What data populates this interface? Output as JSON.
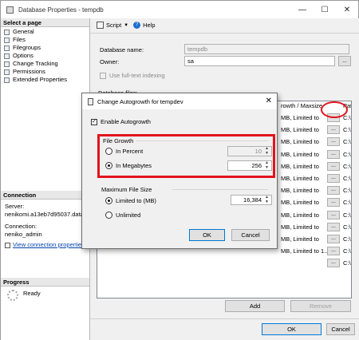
{
  "window": {
    "title": "Database Properties - tempdb"
  },
  "left": {
    "select_page": "Select a page",
    "pages": [
      "General",
      "Files",
      "Filegroups",
      "Options",
      "Change Tracking",
      "Permissions",
      "Extended Properties"
    ],
    "connection_head": "Connection",
    "server_label": "Server:",
    "server_value": "nenikomi.a13eb7d95037.datab",
    "conn_label": "Connection:",
    "conn_value": "neniko_admin",
    "view_conn": "View connection properties",
    "progress_head": "Progress",
    "progress_status": "Ready"
  },
  "toolbar": {
    "script": "Script",
    "help": "Help"
  },
  "form": {
    "dbname_label": "Database name:",
    "dbname_value": "tempdb",
    "owner_label": "Owner:",
    "owner_value": "sa",
    "fulltext_label": "Use full-text indexing",
    "dbfiles_label": "Database files:"
  },
  "grid": {
    "col_growth": "rowth / Maxsize",
    "col_path": "Path",
    "rows": [
      {
        "growth": "MB, Limited to",
        "path": "C:\\"
      },
      {
        "growth": "MB, Limited to",
        "path": "C:\\"
      },
      {
        "growth": "MB, Limited to",
        "path": "C:\\"
      },
      {
        "growth": "MB, Limited to",
        "path": "C:\\"
      },
      {
        "growth": "MB, Limited to",
        "path": "C:\\"
      },
      {
        "growth": "MB, Limited to",
        "path": "C:\\"
      },
      {
        "growth": "MB, Limited to",
        "path": "C:\\"
      },
      {
        "growth": "MB, Limited to",
        "path": "C:\\"
      },
      {
        "growth": "MB, Limited to",
        "path": "C:\\"
      },
      {
        "growth": "MB, Limited to",
        "path": "C:\\"
      },
      {
        "growth": "MB, Limited to",
        "path": "C:\\"
      },
      {
        "growth": "MB, Limited to 1...",
        "path": "C:\\"
      },
      {
        "growth": "",
        "path": "C:\\"
      }
    ],
    "dots": "..."
  },
  "buttons": {
    "add": "Add",
    "remove": "Remove",
    "ok": "OK",
    "cancel": "Cancel"
  },
  "dialog": {
    "title": "Change Autogrowth for tempdev",
    "enable": "Enable Autogrowth",
    "file_growth": "File Growth",
    "in_percent": "In Percent",
    "percent_value": "10",
    "in_megabytes": "In Megabytes",
    "mb_value": "256",
    "max_size": "Maximum File Size",
    "limited": "Limited to (MB)",
    "limited_value": "16,384",
    "unlimited": "Unlimited",
    "ok": "OK",
    "cancel": "Cancel"
  }
}
